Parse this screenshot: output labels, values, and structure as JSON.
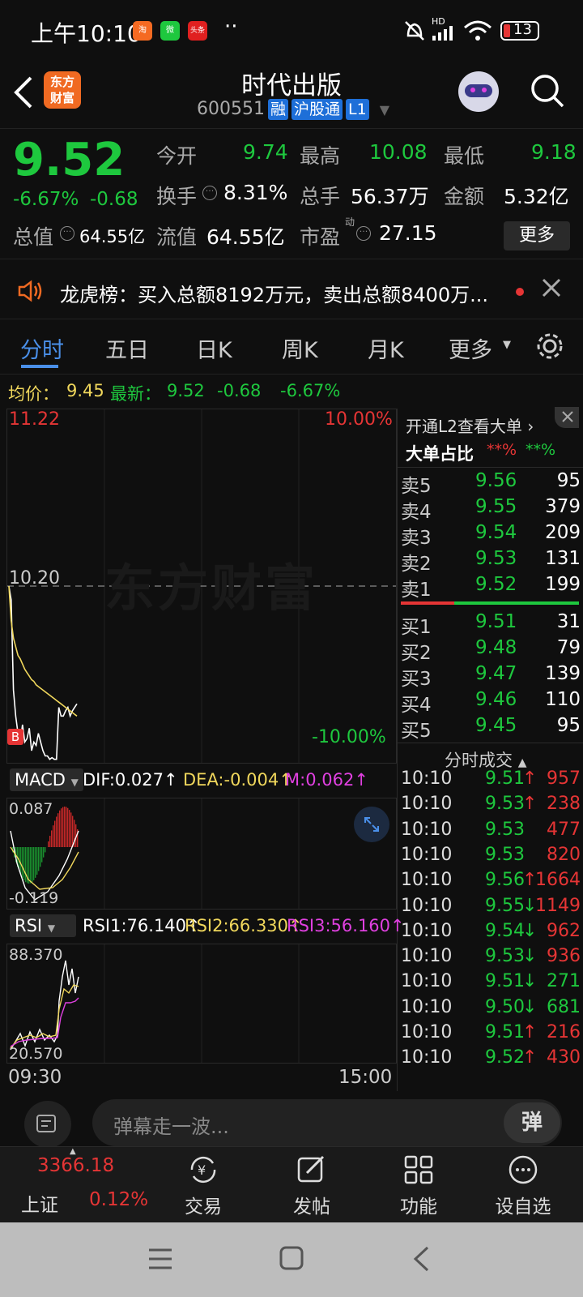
{
  "status_bar": {
    "time": "上午10:10",
    "apps": [
      {
        "name": "taobao",
        "color": "#f56a22",
        "label": "淘"
      },
      {
        "name": "wechat",
        "color": "#1ec83e",
        "label": "微"
      },
      {
        "name": "toutiao",
        "color": "#e02020",
        "label": "头条"
      }
    ],
    "dots": "··",
    "signal_label": "HD",
    "battery": "13"
  },
  "header": {
    "title": "时代出版",
    "code": "600551",
    "tags": [
      "融",
      "沪股通",
      "L1"
    ],
    "logo_line1": "东方",
    "logo_line2": "财富"
  },
  "quote": {
    "price": "9.52",
    "change_pct": "-6.67%",
    "change": "-0.68",
    "open_label": "今开",
    "open": "9.74",
    "high_label": "最高",
    "high": "10.08",
    "low_label": "最低",
    "low": "9.18",
    "turnover_label": "换手",
    "turnover": "8.31%",
    "volume_label": "总手",
    "volume": "56.37万",
    "amount_label": "金额",
    "amount": "5.32亿",
    "mktcap_label": "总值",
    "mktcap": "64.55亿",
    "float_label": "流值",
    "float": "64.55亿",
    "pe_label": "市盈",
    "pe_sup": "动",
    "pe": "27.15",
    "more": "更多"
  },
  "notice": {
    "text": "龙虎榜：买入总额8192万元，卖出总额8400万..."
  },
  "tabs": [
    "分时",
    "五日",
    "日K",
    "周K",
    "月K",
    "更多"
  ],
  "avg_line": {
    "label": "均价：",
    "avg": "9.45",
    "latest_label": "最新：",
    "latest": "9.52",
    "change": "-0.68",
    "change_pct": "-6.67%"
  },
  "chart": {
    "top_price": "11.22",
    "top_pct": "10.00%",
    "mid_price": "10.20",
    "bottom_pct": "-10.00%",
    "watermark": "东方财富",
    "b_marker": "B"
  },
  "chart_data": {
    "type": "line",
    "ylim": [
      9.18,
      11.22
    ],
    "ref_price": 10.2,
    "series": [
      {
        "name": "price",
        "color": "#ffffff",
        "values": [
          10.2,
          10.12,
          9.6,
          9.45,
          9.35,
          9.3,
          9.4,
          9.3,
          9.32,
          9.38,
          9.25,
          9.3,
          9.28,
          9.35,
          9.3,
          9.25,
          9.22,
          9.22,
          9.2,
          9.21,
          9.2,
          9.2,
          9.5,
          9.45,
          9.45,
          9.48,
          9.5,
          9.45,
          9.48,
          9.5,
          9.52
        ]
      },
      {
        "name": "avg",
        "color": "#f0d75c",
        "values": [
          10.2,
          10.0,
          9.9,
          9.85,
          9.8,
          9.78,
          9.75,
          9.72,
          9.7,
          9.68,
          9.66,
          9.65,
          9.63,
          9.62,
          9.61,
          9.6,
          9.59,
          9.58,
          9.57,
          9.56,
          9.55,
          9.54,
          9.53,
          9.52,
          9.51,
          9.5,
          9.49,
          9.48,
          9.47,
          9.46,
          9.45
        ]
      }
    ]
  },
  "macd": {
    "label": "MACD",
    "dif": "DIF:0.027",
    "dea": "DEA:-0.004",
    "m": "M:0.062",
    "top": "0.087",
    "bottom": "-0.119"
  },
  "rsi": {
    "label": "RSI",
    "rsi1": "RSI1:76.140",
    "rsi2": "RSI2:66.330",
    "rsi3": "RSI3:56.160",
    "top": "88.370",
    "bottom": "20.570",
    "time_start": "09:30",
    "time_end": "15:00"
  },
  "right": {
    "l2": "开通L2查看大单",
    "big_label": "大单占比",
    "red_pct": "**%",
    "green_pct": "**%",
    "ticks_label": "分时成交"
  },
  "orderbook": {
    "asks": [
      {
        "label": "卖5",
        "price": "9.56",
        "vol": "95"
      },
      {
        "label": "卖4",
        "price": "9.55",
        "vol": "379"
      },
      {
        "label": "卖3",
        "price": "9.54",
        "vol": "209"
      },
      {
        "label": "卖2",
        "price": "9.53",
        "vol": "131"
      },
      {
        "label": "卖1",
        "price": "9.52",
        "vol": "199"
      }
    ],
    "bids": [
      {
        "label": "买1",
        "price": "9.51",
        "vol": "31"
      },
      {
        "label": "买2",
        "price": "9.48",
        "vol": "79"
      },
      {
        "label": "买3",
        "price": "9.47",
        "vol": "139"
      },
      {
        "label": "买4",
        "price": "9.46",
        "vol": "110"
      },
      {
        "label": "买5",
        "price": "9.45",
        "vol": "95"
      }
    ]
  },
  "ticks": [
    {
      "t": "10:10",
      "p": "9.51",
      "dir": "↑",
      "v": "957",
      "c": "red"
    },
    {
      "t": "10:10",
      "p": "9.53",
      "dir": "↑",
      "v": "238",
      "c": "red"
    },
    {
      "t": "10:10",
      "p": "9.53",
      "dir": "",
      "v": "477",
      "c": "red"
    },
    {
      "t": "10:10",
      "p": "9.53",
      "dir": "",
      "v": "820",
      "c": "red"
    },
    {
      "t": "10:10",
      "p": "9.56",
      "dir": "↑",
      "v": "1664",
      "c": "red"
    },
    {
      "t": "10:10",
      "p": "9.55",
      "dir": "↓",
      "v": "1149",
      "c": "red"
    },
    {
      "t": "10:10",
      "p": "9.54",
      "dir": "↓",
      "v": "962",
      "c": "red"
    },
    {
      "t": "10:10",
      "p": "9.53",
      "dir": "↓",
      "v": "936",
      "c": "red"
    },
    {
      "t": "10:10",
      "p": "9.51",
      "dir": "↓",
      "v": "271",
      "c": "green"
    },
    {
      "t": "10:10",
      "p": "9.50",
      "dir": "↓",
      "v": "681",
      "c": "green"
    },
    {
      "t": "10:10",
      "p": "9.51",
      "dir": "↑",
      "v": "216",
      "c": "red"
    },
    {
      "t": "10:10",
      "p": "9.52",
      "dir": "↑",
      "v": "430",
      "c": "red"
    }
  ],
  "chat": {
    "placeholder": "弹幕走一波...",
    "toggle": "弹"
  },
  "nav": {
    "index_value": "3366.18",
    "index_name": "上证",
    "index_pct": "0.12%",
    "items": [
      "交易",
      "发帖",
      "功能",
      "设自选"
    ]
  },
  "colors": {
    "up": "#e53535",
    "down": "#1ec83e",
    "accent": "#4a8fe8",
    "avg": "#f0d75c",
    "macd_dea": "#f0d75c",
    "rsi3": "#e040e0"
  }
}
